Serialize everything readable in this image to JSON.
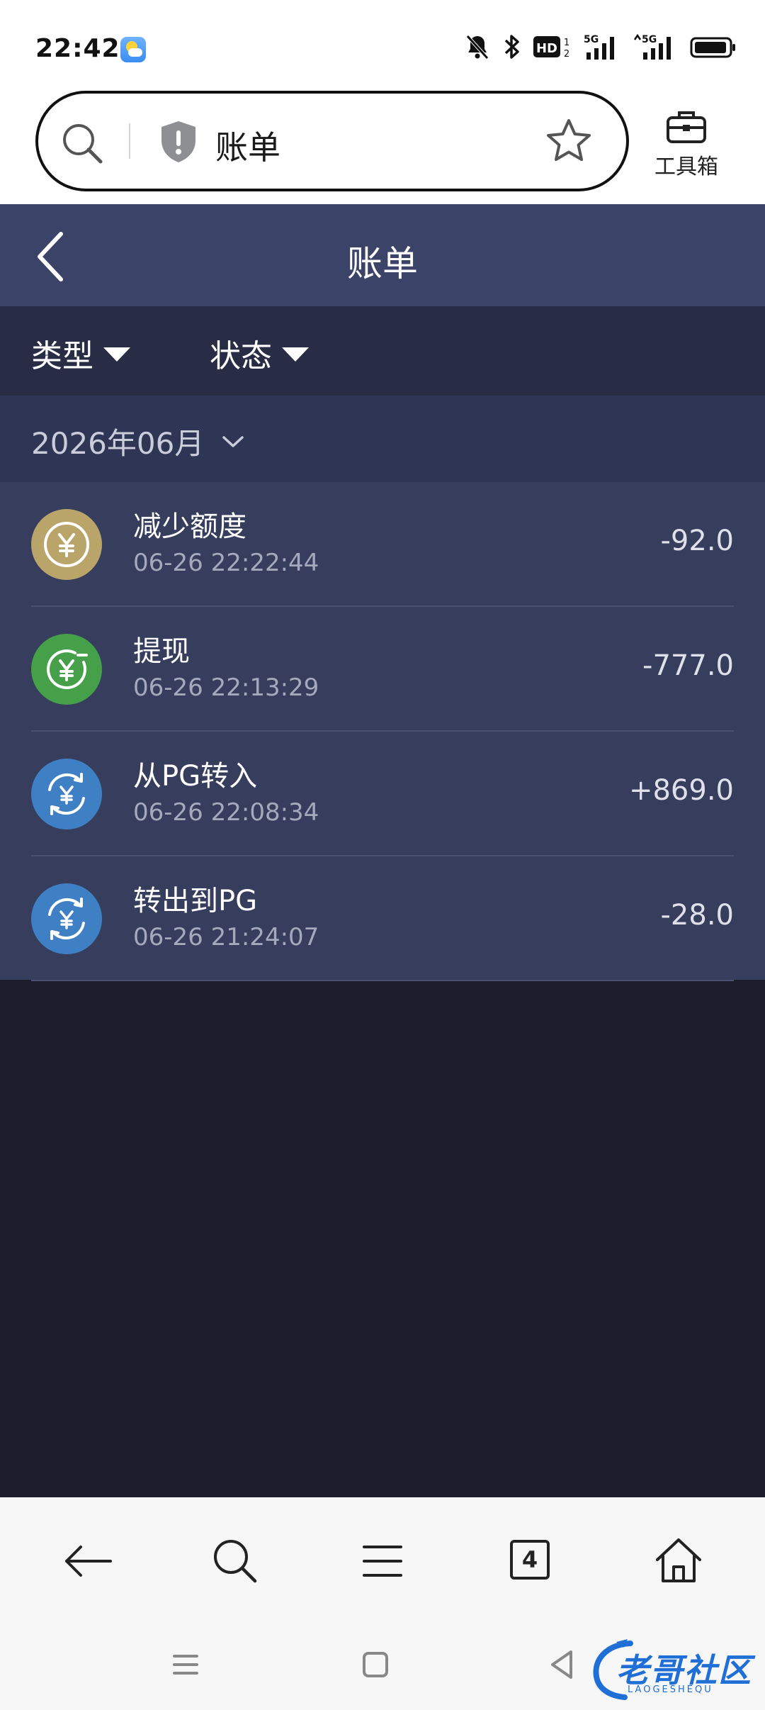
{
  "status_bar": {
    "time": "22:42"
  },
  "address_bar": {
    "url_text": "账单",
    "toolbox_label": "工具箱"
  },
  "page": {
    "title": "账单"
  },
  "filters": {
    "type_label": "类型",
    "status_label": "状态"
  },
  "month_selector": {
    "label": "2026年06月"
  },
  "transactions": [
    {
      "title": "减少额度",
      "time": "06-26 22:22:44",
      "amount": "-92.0",
      "icon": "yen-coin-icon",
      "color": "#b9a46a"
    },
    {
      "title": "提现",
      "time": "06-26 22:13:29",
      "amount": "-777.0",
      "icon": "withdraw-yen-icon",
      "color": "#46a04a"
    },
    {
      "title": "从PG转入",
      "time": "06-26 22:08:34",
      "amount": "+869.0",
      "icon": "transfer-yen-icon",
      "color": "#3f7fc4"
    },
    {
      "title": "转出到PG",
      "time": "06-26 21:24:07",
      "amount": "-28.0",
      "icon": "transfer-yen-icon",
      "color": "#3f7fc4"
    }
  ],
  "browser_nav": {
    "tab_count": "4"
  },
  "watermark": {
    "text": "老哥社区",
    "sub": "LAOGESHEQU"
  },
  "colors": {
    "header_bg": "#3b4468",
    "filter_bg": "#282d45",
    "month_bg": "#2f3554",
    "list_bg": "#373d5c",
    "page_bg": "#1b1d2b"
  }
}
